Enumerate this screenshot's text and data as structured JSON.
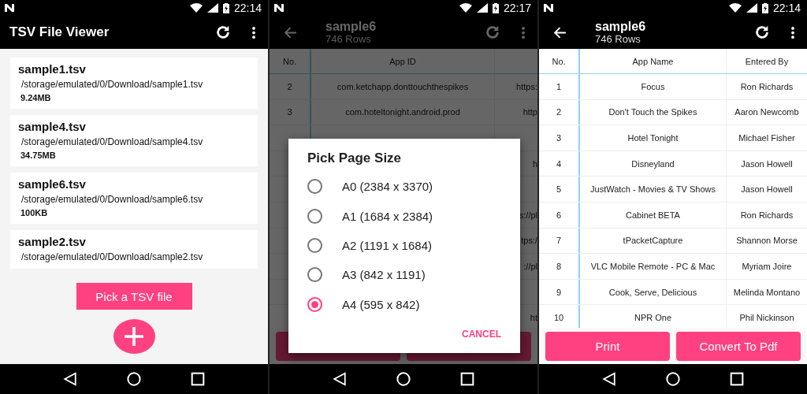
{
  "screens": [
    {
      "kind": "file_list",
      "time": "22:14",
      "title": "TSV File Viewer",
      "files": [
        {
          "name": "sample1.tsv",
          "path": "/storage/emulated/0/Download/sample1.tsv",
          "size": "9.24MB"
        },
        {
          "name": "sample4.tsv",
          "path": "/storage/emulated/0/Download/sample4.tsv",
          "size": "34.75MB"
        },
        {
          "name": "sample6.tsv",
          "path": "/storage/emulated/0/Download/sample6.tsv",
          "size": "100KB"
        },
        {
          "name": "sample2.tsv",
          "path": "/storage/emulated/0/Download/sample2.tsv"
        }
      ],
      "pick_button": "Pick a TSV file"
    },
    {
      "kind": "dialog",
      "time": "22:17",
      "title": "sample6",
      "subtitle": "746 Rows",
      "columns": [
        "No.",
        "App ID"
      ],
      "rows": [
        {
          "no": "2",
          "app_id": "com.ketchapp.donttouchthespikes",
          "column_3": "https:"
        },
        {
          "no": "3",
          "app_id": "com.hoteltonight.android.prod",
          "column_3": "http"
        },
        {},
        {
          "column_3": "h"
        },
        {},
        {
          "column_3": "s://pl"
        },
        {
          "column_3": "tps:/"
        },
        {
          "column_3": "://pl"
        },
        {},
        {
          "column_3": "ht"
        }
      ],
      "dialog": {
        "title": "Pick Page Size",
        "options": [
          {
            "label": "A0 (2384 x 3370)",
            "selected": false
          },
          {
            "label": "A1 (1684 x 2384)",
            "selected": false
          },
          {
            "label": "A2 (1191 x 1684)",
            "selected": false
          },
          {
            "label": "A3 (842 x 1191)",
            "selected": false
          },
          {
            "label": "A4 (595 x 842)",
            "selected": true
          }
        ],
        "cancel": "CANCEL"
      }
    },
    {
      "kind": "table",
      "time": "22:14",
      "title": "sample6",
      "subtitle": "746 Rows",
      "columns": [
        "No.",
        "App Name",
        "Entered By"
      ],
      "rows": [
        [
          "1",
          "Focus",
          "Ron Richards"
        ],
        [
          "2",
          "Don't Touch the Spikes",
          "Aaron Newcomb"
        ],
        [
          "3",
          "Hotel Tonight",
          "Michael Fisher"
        ],
        [
          "4",
          "Disneyland",
          "Jason Howell"
        ],
        [
          "5",
          "JustWatch - Movies & TV Shows",
          "Jason Howell"
        ],
        [
          "6",
          "Cabinet BETA",
          "Ron Richards"
        ],
        [
          "7",
          "tPacketCapture",
          "Shannon Morse"
        ],
        [
          "8",
          "VLC Mobile Remote - PC & Mac",
          "Myriam Joire"
        ],
        [
          "9",
          "Cook, Serve, Delicious",
          "Melinda Montano"
        ],
        [
          "10",
          "NPR One",
          "Phil Nickinson"
        ]
      ],
      "buttons": [
        "Print",
        "Convert To Pdf"
      ]
    }
  ]
}
